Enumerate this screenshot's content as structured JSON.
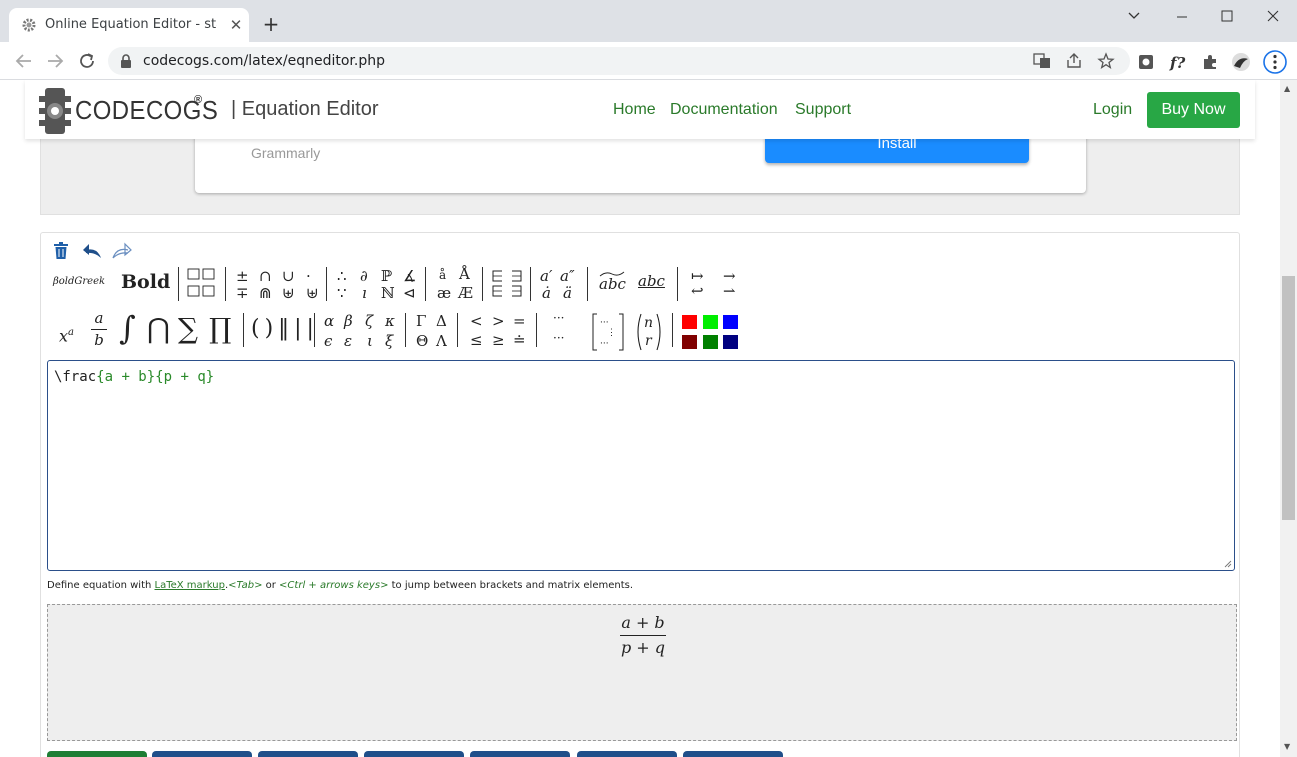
{
  "browser": {
    "tab_title": "Online Equation Editor - standa",
    "tab_close": "✕",
    "new_tab": "+",
    "url": "codecogs.com/latex/eqneditor.php"
  },
  "ad": {
    "advertiser": "Grammarly",
    "install_label": "Install"
  },
  "header": {
    "logo": "CODECOGS",
    "logo_reg": "®",
    "title": "| Equation Editor",
    "nav": [
      "Home",
      "Documentation",
      "Support"
    ],
    "login": "Login",
    "buy_now": "Buy Now"
  },
  "toolbar": {
    "bold_greek": "𝛽𝑜𝑙𝑑𝐺𝑟𝑒𝑒𝑘",
    "bold": "Bold",
    "row1_groups": [
      [
        "±",
        "∩",
        "∪",
        "·",
        "∓",
        "⋒",
        "⊎",
        "⊎"
      ],
      [
        "∴",
        "∂",
        "ℙ",
        "∡",
        "∵",
        "ı",
        "ℕ",
        "⊲"
      ],
      [
        "å",
        "Å",
        "æ",
        "Æ"
      ],
      [
        "a′",
        "a″",
        "ȧ",
        "ä"
      ],
      [
        "abc",
        "abc"
      ],
      [
        "↦",
        "→",
        "↩",
        "⇀"
      ]
    ],
    "row2": {
      "power": "x",
      "power_sup": "a",
      "frac_num": "a",
      "frac_den": "b",
      "integral": "∫",
      "bigcap": "⋂",
      "sum": "∑",
      "prod": "∏",
      "brackets": "( ) ‖ | |",
      "greek_lower": [
        "α",
        "β",
        "ζ",
        "κ",
        "ϵ",
        "ε",
        "ι",
        "ξ"
      ],
      "greek_upper": [
        "Γ",
        "Δ",
        "Θ",
        "Λ"
      ],
      "relations": [
        "<",
        ">",
        "=",
        "≤",
        "≥",
        "≐"
      ],
      "dots": [
        "···",
        "···"
      ],
      "binom_n": "n",
      "binom_r": "r"
    },
    "colors": [
      "#ff0000",
      "#00ee00",
      "#0000ff",
      "#800000",
      "#008000",
      "#000080"
    ]
  },
  "editor": {
    "cmd": "\\frac",
    "arg1": "{a + b}",
    "arg2": "{p + q}"
  },
  "hint": {
    "prefix": "Define equation with ",
    "link": "LaTeX markup",
    "dot": ".",
    "tab_key": "<Tab>",
    "or": " or ",
    "ctrl_keys": "<Ctrl + arrows keys>",
    "suffix": " to jump between brackets and matrix elements."
  },
  "preview": {
    "numerator": "a + b",
    "denominator": "p + q"
  }
}
